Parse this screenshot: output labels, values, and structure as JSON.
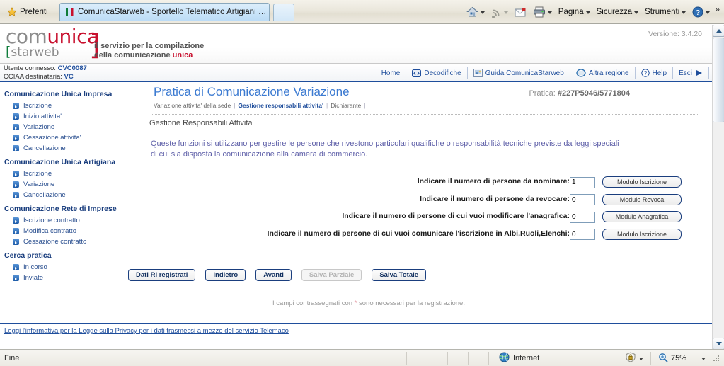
{
  "browser": {
    "favorites_label": "Preferiti",
    "favorites_icon": "star-icon",
    "tab_title": "ComunicaStarweb - Sportello Telematico Artigiani e Re...",
    "tab_favicon": "comunica-favicon",
    "new_tab_label": "",
    "toolbar": [
      {
        "label": "",
        "icon": "home-icon",
        "caret": true
      },
      {
        "label": "",
        "icon": "feeds-icon",
        "caret": true,
        "dim_caret": true
      },
      {
        "label": "",
        "icon": "read-mail-icon",
        "caret": false
      },
      {
        "label": "",
        "icon": "print-icon",
        "caret": true
      },
      {
        "label": "Pagina",
        "icon": "",
        "caret": true
      },
      {
        "label": "Sicurezza",
        "icon": "",
        "caret": true
      },
      {
        "label": "Strumenti",
        "icon": "",
        "caret": true
      },
      {
        "label": "",
        "icon": "help-icon",
        "caret": true
      }
    ],
    "overflow_glyph": "»"
  },
  "header": {
    "logo": {
      "part1": "com",
      "part2": "unica",
      "bracket_left": "[",
      "starweb": "starweb",
      "bracket_right": "]"
    },
    "tagline_line1": "il servizio per la compilazione",
    "tagline_line2_pre": "della comunicazione ",
    "tagline_line2_accent": "unica",
    "version": "Versione: 3.4.20"
  },
  "userbar": {
    "user_label": "Utente connesso:",
    "user_value": "CVC0087",
    "cciaa_label": "CCIAA destinataria:",
    "cciaa_value": "VC",
    "links": [
      {
        "label": "Home",
        "icon": ""
      },
      {
        "label": "Decodifiche",
        "icon": "decode-icon"
      },
      {
        "label": "Guida ComunicaStarweb",
        "icon": "guide-icon"
      },
      {
        "label": "Altra regione",
        "icon": "globe-icon"
      },
      {
        "label": "Help",
        "icon": "help-circle-icon"
      },
      {
        "label": "Esci",
        "icon": "exit-arrow-icon"
      }
    ]
  },
  "sidebar": {
    "groups": [
      {
        "title": "Comunicazione Unica Impresa",
        "items": [
          "Iscrizione",
          "Inizio attivita'",
          "Variazione",
          "Cessazione attivita'",
          "Cancellazione"
        ]
      },
      {
        "title": "Comunicazione Unica Artigiana",
        "items": [
          "Iscrizione",
          "Variazione",
          "Cancellazione"
        ]
      },
      {
        "title": "Comunicazione Rete di Imprese",
        "items": [
          "Iscrizione contratto",
          "Modifica contratto",
          "Cessazione contratto"
        ]
      },
      {
        "title": "Cerca pratica",
        "items": [
          "In corso",
          "Inviate"
        ]
      }
    ]
  },
  "main": {
    "page_title": "Pratica di Comunicazione Variazione",
    "practice_label": "Pratica:",
    "practice_number": "#227P5946/5771804",
    "breadcrumbs": [
      {
        "label": "Variazione attivita' della sede",
        "active": false
      },
      {
        "label": "Gestione responsabili attivita'",
        "active": true
      },
      {
        "label": "Dichiarante",
        "active": false
      }
    ],
    "section_heading": "Gestione Responsabili Attivita'",
    "intro_line1": "Queste funzioni si utilizzano per gestire le persone che rivestono particolari qualifiche o responsabilità tecniche previste da leggi speciali",
    "intro_line2": "di cui sia disposta la comunicazione alla camera di commercio.",
    "form_rows": [
      {
        "label": "Indicare il numero di persone da nominare:",
        "value": "1",
        "button": "Modulo Iscrizione"
      },
      {
        "label": "Indicare il numero di persone da revocare:",
        "value": "0",
        "button": "Modulo Revoca"
      },
      {
        "label": "Indicare il numero di persone di cui vuoi modificare l'anagrafica:",
        "value": "0",
        "button": "Modulo Anagrafica"
      },
      {
        "label": "Indicare il numero di persone di cui vuoi comunicare l'iscrizione in Albi,Ruoli,Elenchi:",
        "value": "0",
        "button": "Modulo Iscrizione"
      }
    ],
    "actions": [
      {
        "label": "Dati RI registrati",
        "disabled": false
      },
      {
        "label": "Indietro",
        "disabled": false
      },
      {
        "label": "Avanti",
        "disabled": false
      },
      {
        "label": "Salva Parziale",
        "disabled": true
      },
      {
        "label": "Salva Totale",
        "disabled": false
      }
    ],
    "required_note_pre": "I campi contrassegnati con ",
    "required_note_star": "*",
    "required_note_post": " sono necessari per la registrazione."
  },
  "footer": {
    "privacy_link": "Leggi l'informativa per la Legge sulla Privacy per i dati trasmessi a mezzo del servizio Telemaco"
  },
  "statusbar": {
    "status": "Fine",
    "zone_label": "Internet",
    "zone_icon": "globe-icon",
    "protected_icon": "protected-mode-icon",
    "zoom_icon": "zoom-icon",
    "zoom_level": "75%"
  },
  "colors": {
    "accent_blue": "#1f4e9c",
    "title_blue": "#3b7ad1",
    "logo_red": "#c8102e",
    "logo_green": "#0e7c3a",
    "intro_purple": "#5e5fa8"
  }
}
